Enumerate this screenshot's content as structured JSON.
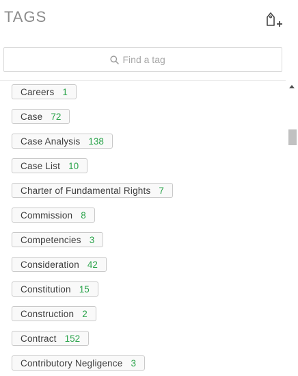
{
  "header": {
    "title": "TAGS",
    "new_tag_icon": "tag-add-icon"
  },
  "search": {
    "placeholder": "Find a tag",
    "value": "",
    "icon": "search-icon"
  },
  "tags": [
    {
      "name": "Careers",
      "count": "1"
    },
    {
      "name": "Case",
      "count": "72"
    },
    {
      "name": "Case Analysis",
      "count": "138"
    },
    {
      "name": "Case List",
      "count": "10"
    },
    {
      "name": "Charter of Fundamental Rights",
      "count": "7"
    },
    {
      "name": "Commission",
      "count": "8"
    },
    {
      "name": "Competencies",
      "count": "3"
    },
    {
      "name": "Consideration",
      "count": "42"
    },
    {
      "name": "Constitution",
      "count": "15"
    },
    {
      "name": "Construction",
      "count": "2"
    },
    {
      "name": "Contract",
      "count": "152"
    },
    {
      "name": "Contributory Negligence",
      "count": "3"
    }
  ],
  "colors": {
    "count_green": "#2aa34a",
    "title_gray": "#8c8c8c",
    "tag_border": "#c9c9c9"
  }
}
